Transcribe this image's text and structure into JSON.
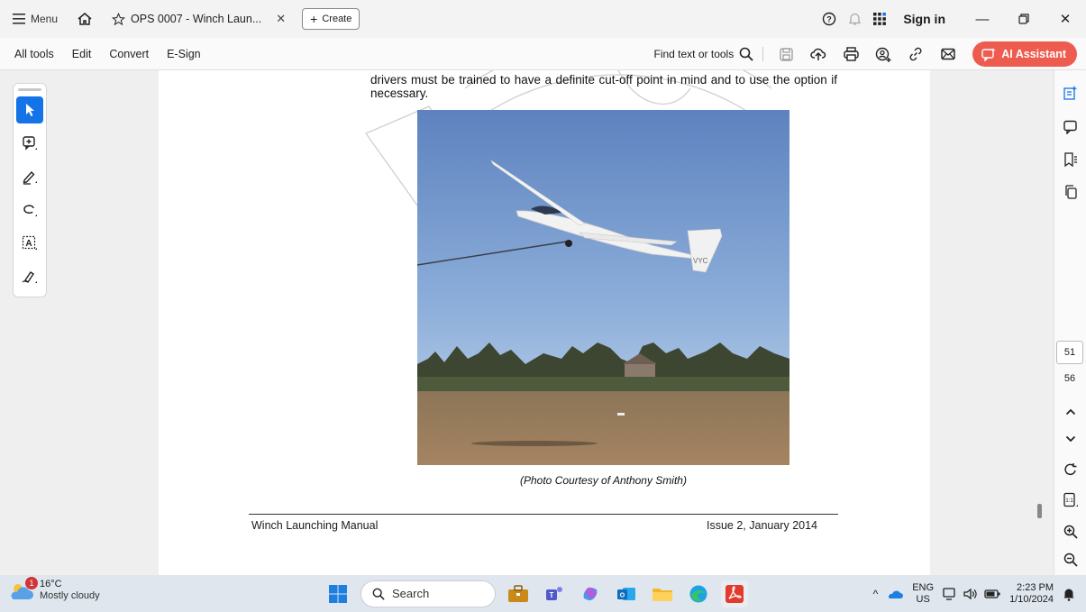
{
  "titlebar": {
    "menu_label": "Menu",
    "tab_title": "OPS 0007 - Winch Laun...",
    "create_label": "Create",
    "signin_label": "Sign in"
  },
  "toolbar": {
    "items": [
      "All tools",
      "Edit",
      "Convert",
      "E-Sign"
    ],
    "find_label": "Find text or tools",
    "ai_label": "AI Assistant"
  },
  "document": {
    "body_text": "drivers must be trained to have a definite cut-off point in mind and to use the option if necessary.",
    "caption": "(Photo Courtesy of Anthony Smith)",
    "footer_left": "Winch Launching Manual",
    "footer_right": "Issue 2, January 2014",
    "glider_tail_mark": "VYC"
  },
  "navigation": {
    "current_page": "51",
    "total_pages": "56"
  },
  "taskbar": {
    "weather_badge": "1",
    "temperature": "16°C",
    "weather_desc": "Mostly cloudy",
    "search_label": "Search",
    "lang_top": "ENG",
    "lang_bottom": "US",
    "time": "2:23 PM",
    "date": "1/10/2024"
  },
  "colors": {
    "accent": "#1473e6",
    "ai_button": "#ee5b4f"
  }
}
